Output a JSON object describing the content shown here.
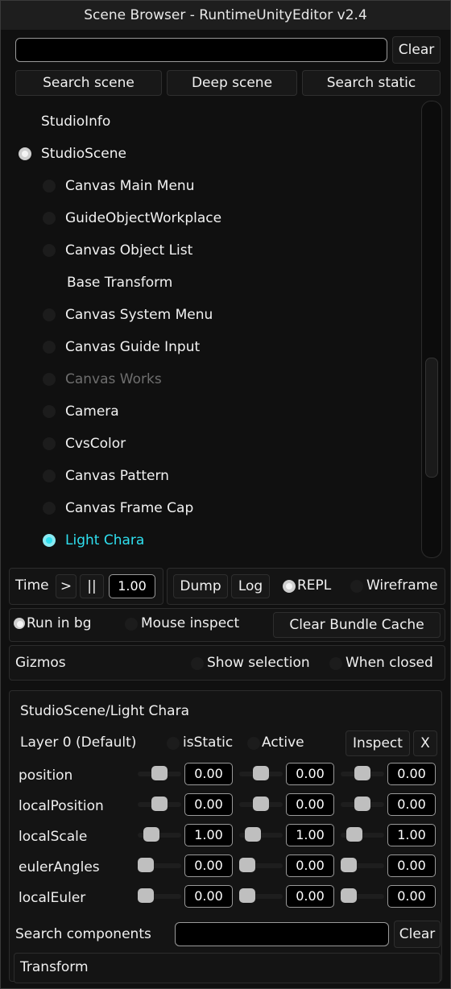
{
  "window": {
    "title": "Scene Browser - RuntimeUnityEditor v2.4"
  },
  "search": {
    "value": "",
    "clear_label": "Clear"
  },
  "search_buttons": {
    "scene": "Search scene",
    "deep": "Deep scene",
    "static": "Search static"
  },
  "tree": [
    {
      "label": "StudioInfo",
      "indent": 0,
      "radio": "none"
    },
    {
      "label": "StudioScene",
      "indent": 0,
      "radio": "on"
    },
    {
      "label": "Canvas Main Menu",
      "indent": 1,
      "radio": "off"
    },
    {
      "label": "GuideObjectWorkplace",
      "indent": 1,
      "radio": "off"
    },
    {
      "label": "Canvas Object List",
      "indent": 1,
      "radio": "off"
    },
    {
      "label": "Base Transform",
      "indent": 1,
      "radio": "none"
    },
    {
      "label": "Canvas System Menu",
      "indent": 1,
      "radio": "off"
    },
    {
      "label": "Canvas Guide Input",
      "indent": 1,
      "radio": "off"
    },
    {
      "label": "Canvas Works",
      "indent": 1,
      "radio": "off",
      "state": "disabled"
    },
    {
      "label": "Camera",
      "indent": 1,
      "radio": "off"
    },
    {
      "label": "CvsColor",
      "indent": 1,
      "radio": "off"
    },
    {
      "label": "Canvas Pattern",
      "indent": 1,
      "radio": "off"
    },
    {
      "label": "Canvas Frame Cap",
      "indent": 1,
      "radio": "off"
    },
    {
      "label": "Light Chara",
      "indent": 1,
      "radio": "on",
      "state": "selected"
    }
  ],
  "colors": {
    "selected": "#2fe0f0",
    "disabled": "#6e6e6e",
    "text": "#f2f2f2"
  },
  "controls": {
    "time_label": "Time",
    "play_label": ">",
    "pause_label": "||",
    "time_value": "1.00",
    "dump_label": "Dump",
    "log_label": "Log",
    "repl_label": "REPL",
    "repl_checked": true,
    "wireframe_label": "Wireframe",
    "wireframe_checked": false,
    "run_in_bg_label": "Run in bg",
    "run_in_bg_checked": true,
    "mouse_inspect_label": "Mouse inspect",
    "mouse_inspect_checked": false,
    "clear_cache_label": "Clear Bundle Cache"
  },
  "gizmos": {
    "label": "Gizmos",
    "show_selection_label": "Show selection",
    "show_selection_checked": false,
    "when_closed_label": "When closed",
    "when_closed_checked": false
  },
  "inspector": {
    "path": "StudioScene/Light Chara",
    "layer": "Layer 0 (Default)",
    "is_static_label": "isStatic",
    "is_static_checked": false,
    "active_label": "Active",
    "active_checked": false,
    "inspect_label": "Inspect",
    "close_label": "X",
    "rows": [
      {
        "label": "position",
        "values": [
          "0.00",
          "0.00",
          "0.00"
        ],
        "slider_level": [
          0.5,
          0.5,
          0.5
        ]
      },
      {
        "label": "localPosition",
        "values": [
          "0.00",
          "0.00",
          "0.00"
        ],
        "slider_level": [
          0.5,
          0.5,
          0.5
        ]
      },
      {
        "label": "localScale",
        "values": [
          "1.00",
          "1.00",
          "1.00"
        ],
        "slider_level": [
          0.2,
          0.2,
          0.2
        ]
      },
      {
        "label": "eulerAngles",
        "values": [
          "0.00",
          "0.00",
          "0.00"
        ],
        "slider_level": [
          0.0,
          0.0,
          0.0
        ]
      },
      {
        "label": "localEuler",
        "values": [
          "0.00",
          "0.00",
          "0.00"
        ],
        "slider_level": [
          0.0,
          0.0,
          0.0
        ]
      }
    ]
  },
  "components": {
    "search_label": "Search components",
    "search_value": "",
    "clear_label": "Clear",
    "items": [
      "Transform"
    ]
  },
  "scrollbar": {
    "position": 0.77,
    "visible_fraction": 0.26
  }
}
